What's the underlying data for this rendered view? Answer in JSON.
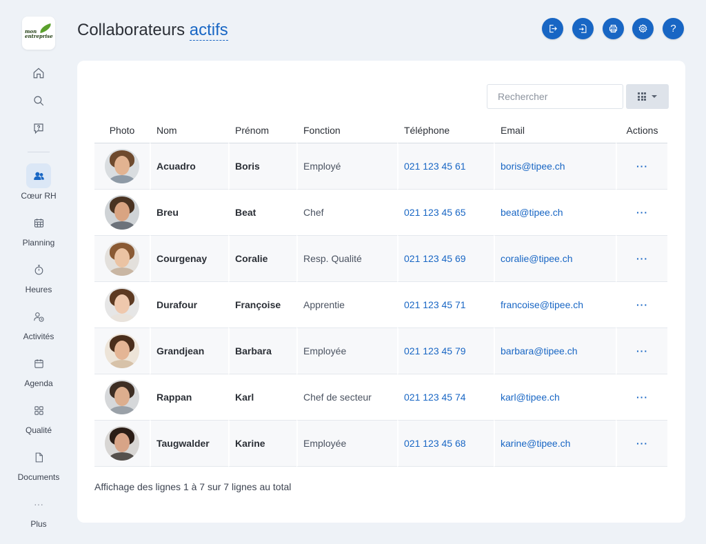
{
  "sidebar": {
    "logo": {
      "line1": "mon",
      "line2": "entreprise"
    },
    "nav_items": [
      {
        "label": "Cœur RH",
        "icon": "users-icon",
        "active": true
      },
      {
        "label": "Planning",
        "icon": "calendar-grid-icon"
      },
      {
        "label": "Heures",
        "icon": "stopwatch-icon"
      },
      {
        "label": "Activités",
        "icon": "user-clock-icon"
      },
      {
        "label": "Agenda",
        "icon": "calendar-icon"
      },
      {
        "label": "Qualité",
        "icon": "apps-icon"
      },
      {
        "label": "Documents",
        "icon": "document-icon"
      },
      {
        "label": "Plus",
        "icon": "more-icon",
        "glyph": "···"
      }
    ]
  },
  "header": {
    "title_main": "Collaborateurs",
    "title_accent": "actifs",
    "actions": [
      "export-icon",
      "import-icon",
      "print-icon",
      "gear-icon",
      "help-icon"
    ],
    "help_glyph": "?"
  },
  "toolbar": {
    "search_placeholder": "Rechercher"
  },
  "table": {
    "columns": [
      "Photo",
      "Nom",
      "Prénom",
      "Fonction",
      "Téléphone",
      "Email",
      "Actions"
    ],
    "rows": [
      {
        "nom": "Acuadro",
        "prenom": "Boris",
        "fonction": "Employé",
        "tel": "021 123 45 61",
        "email": "boris@tipee.ch",
        "actions": "···"
      },
      {
        "nom": "Breu",
        "prenom": "Beat",
        "fonction": "Chef",
        "tel": "021 123 45 65",
        "email": "beat@tipee.ch",
        "actions": "···"
      },
      {
        "nom": "Courgenay",
        "prenom": "Coralie",
        "fonction": "Resp. Qualité",
        "tel": "021 123 45 69",
        "email": "coralie@tipee.ch",
        "actions": "···"
      },
      {
        "nom": "Durafour",
        "prenom": "Françoise",
        "fonction": "Apprentie",
        "tel": "021 123 45 71",
        "email": "francoise@tipee.ch",
        "actions": "···"
      },
      {
        "nom": "Grandjean",
        "prenom": "Barbara",
        "fonction": "Employée",
        "tel": "021 123 45 79",
        "email": "barbara@tipee.ch",
        "actions": "···"
      },
      {
        "nom": "Rappan",
        "prenom": "Karl",
        "fonction": "Chef de secteur",
        "tel": "021 123 45 74",
        "email": "karl@tipee.ch",
        "actions": "···"
      },
      {
        "nom": "Taugwalder",
        "prenom": "Karine",
        "fonction": "Employée",
        "tel": "021 123 45 68",
        "email": "karine@tipee.ch",
        "actions": "···"
      }
    ]
  },
  "footer": {
    "summary": "Affichage des lignes 1 à 7 sur 7 lignes au total"
  },
  "colors": {
    "accent": "#1866c4",
    "background": "#eef2f7",
    "card": "#ffffff"
  }
}
